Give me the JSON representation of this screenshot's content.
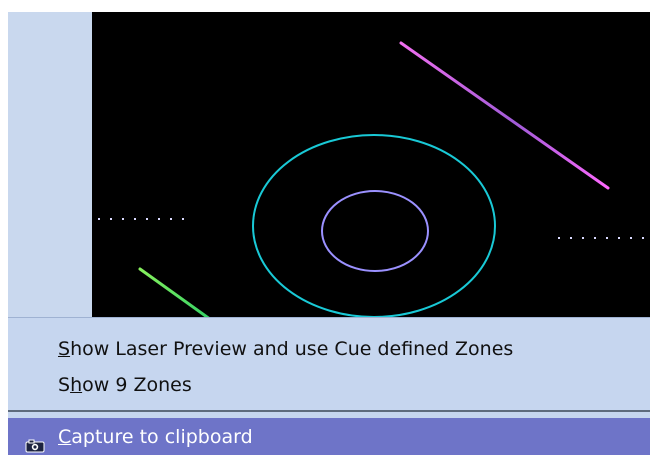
{
  "menu": {
    "items": [
      {
        "text_before": "",
        "accelerator": "S",
        "text_after": "how Laser Preview and use Cue defined Zones"
      },
      {
        "text_before": "S",
        "accelerator": "h",
        "text_after": "ow 9 Zones"
      },
      {
        "text_before": "",
        "accelerator": "C",
        "text_after": "apture to clipboard",
        "icon": "camera-icon",
        "highlighted": true
      }
    ]
  },
  "colors": {
    "menu_background": "#c6d6ef",
    "menu_highlight": "#6e74c8",
    "preview_background": "#000000",
    "cyan_circle": "#19c9d6",
    "lavender_circle": "#9b91ff",
    "magenta_line": "#ff66f0",
    "green_line": "#7cf04c"
  }
}
